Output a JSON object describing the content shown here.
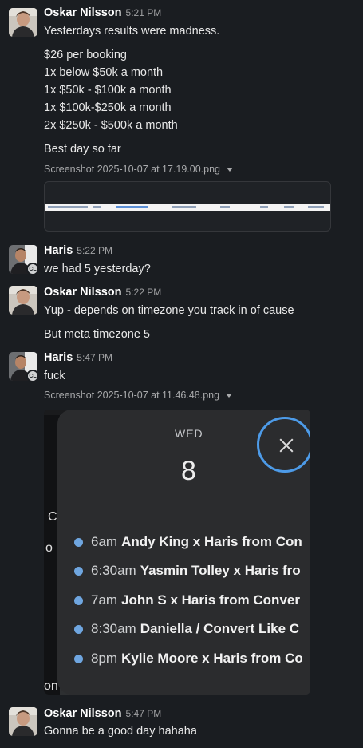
{
  "messages": [
    {
      "author": "Oskar Nilsson",
      "time": "5:21 PM",
      "lines": [
        "Yesterdays results were madness.",
        "$26 per booking",
        "1x below $50k a month",
        "1x $50k - $100k a month",
        "1x $100k-$250k a month",
        "2x $250k - $500k a month",
        "Best day so far"
      ],
      "attachment": "Screenshot 2025-10-07 at 17.19.00.png"
    },
    {
      "author": "Haris",
      "time": "5:22 PM",
      "badge": "CL",
      "lines": [
        "we had 5 yesterday?"
      ]
    },
    {
      "author": "Oskar Nilsson",
      "time": "5:22 PM",
      "lines": [
        "Yup - depends on timezone you track in of cause",
        "But meta timezone 5"
      ]
    },
    {
      "author": "Haris",
      "time": "5:47 PM",
      "badge": "CL",
      "lines": [
        "fuck"
      ],
      "attachment": "Screenshot 2025-10-07 at 11.46.48.png",
      "calendar": {
        "weekday": "WED",
        "day": "8",
        "events": [
          {
            "time": "6am",
            "title": "Andy King x Haris from Con"
          },
          {
            "time": "6:30am",
            "title": "Yasmin Tolley x Haris fro"
          },
          {
            "time": "7am",
            "title": "John S x Haris from Conver"
          },
          {
            "time": "8:30am",
            "title": "Daniella / Convert Like C"
          },
          {
            "time": "8pm",
            "title": "Kylie Moore x Haris from Co"
          }
        ],
        "side_fragments": [
          "C",
          "o",
          "on"
        ]
      }
    },
    {
      "author": "Oskar Nilsson",
      "time": "5:47 PM",
      "lines": [
        "Gonna be a good day hahaha"
      ]
    }
  ],
  "colors": {
    "background": "#1a1d21",
    "new_divider": "#8a3b3b",
    "calendar_dot": "#6fa6e0",
    "close_ring": "#4d9be8"
  }
}
